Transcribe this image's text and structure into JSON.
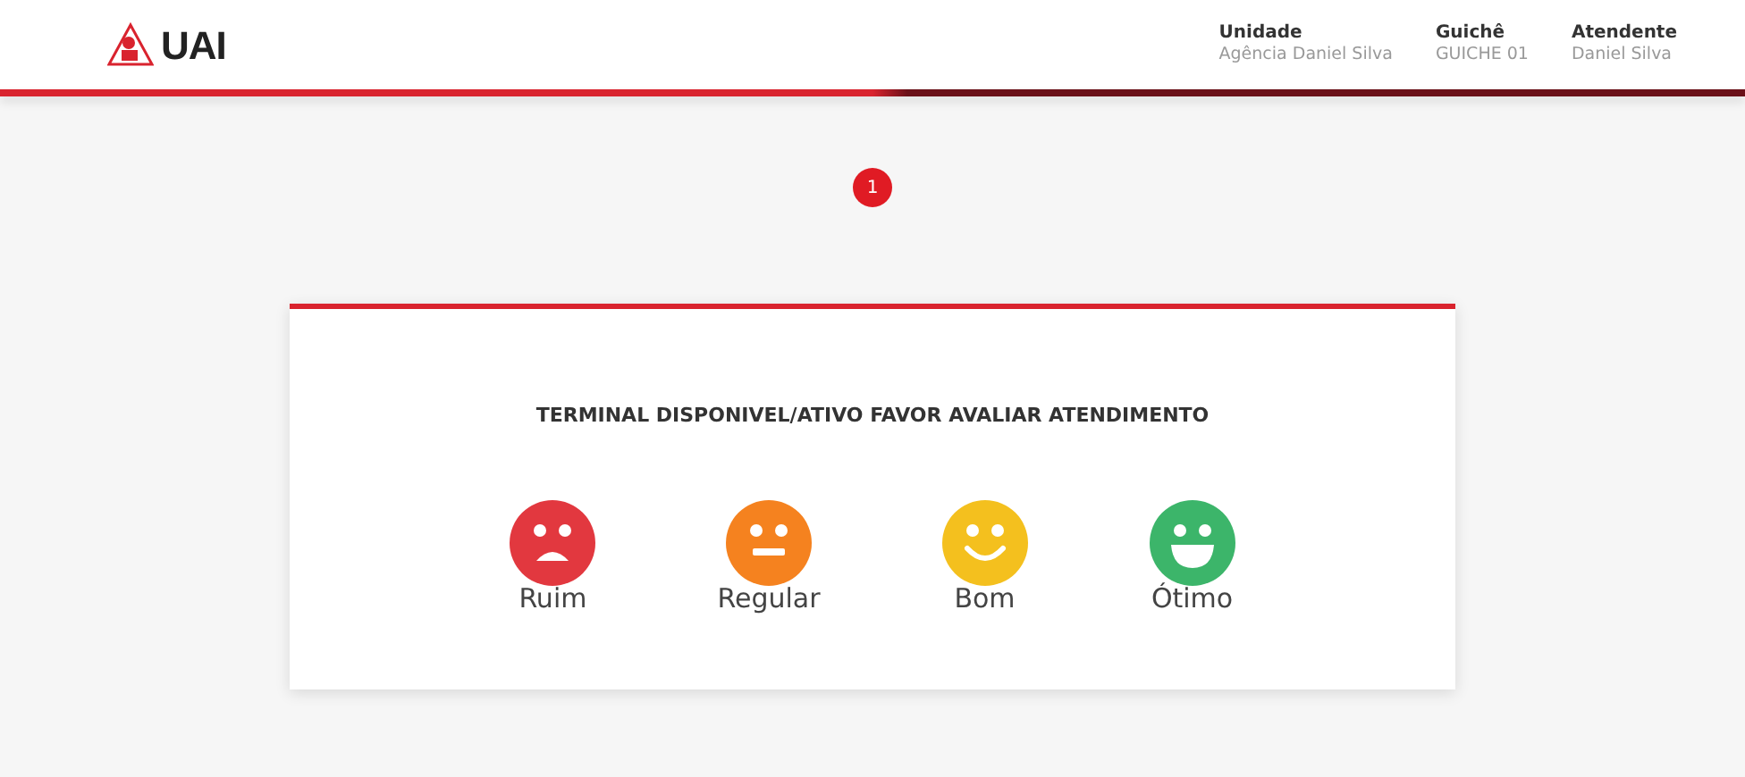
{
  "header": {
    "logo": "UAI",
    "info": [
      {
        "label": "Unidade",
        "value": "Agência Daniel Silva"
      },
      {
        "label": "Guichê",
        "value": "GUICHE 01"
      },
      {
        "label": "Atendente",
        "value": "Daniel Silva"
      }
    ]
  },
  "badge": "1",
  "card": {
    "message": "TERMINAL DISPONIVEL/ATIVO FAVOR AVALIAR ATENDIMENTO",
    "ratings": [
      {
        "label": "Ruim",
        "kind": "sad",
        "color": "#e2383f"
      },
      {
        "label": "Regular",
        "kind": "neutral",
        "color": "#f5821f"
      },
      {
        "label": "Bom",
        "kind": "smile",
        "color": "#f4c01e"
      },
      {
        "label": "Ótimo",
        "kind": "grin",
        "color": "#3cb56a"
      }
    ]
  }
}
